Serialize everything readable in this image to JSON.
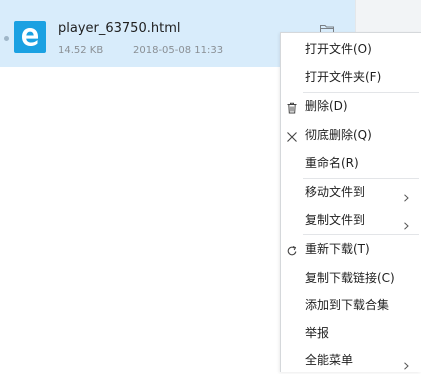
{
  "download": {
    "file_name": "player_63750.html",
    "size": "14.52 KB",
    "time": "2018-05-08 11:33",
    "file_icon": "edge-browser-icon",
    "folder_icon": "open-folder-icon"
  },
  "menu": {
    "open_file": "打开文件(O)",
    "open_folder": "打开文件夹(F)",
    "delete": "删除(D)",
    "delete_permanent": "彻底删除(Q)",
    "rename": "重命名(R)",
    "move_to": "移动文件到",
    "copy_to": "复制文件到",
    "redownload": "重新下载(T)",
    "copy_link": "复制下载链接(C)",
    "add_to_collection": "添加到下载合集",
    "report": "举报",
    "all_menu": "全能菜单"
  },
  "colors": {
    "row_selected": "#d8ecfb",
    "file_icon_bg": "#1ba1e2",
    "menu_bg": "#ffffff"
  }
}
